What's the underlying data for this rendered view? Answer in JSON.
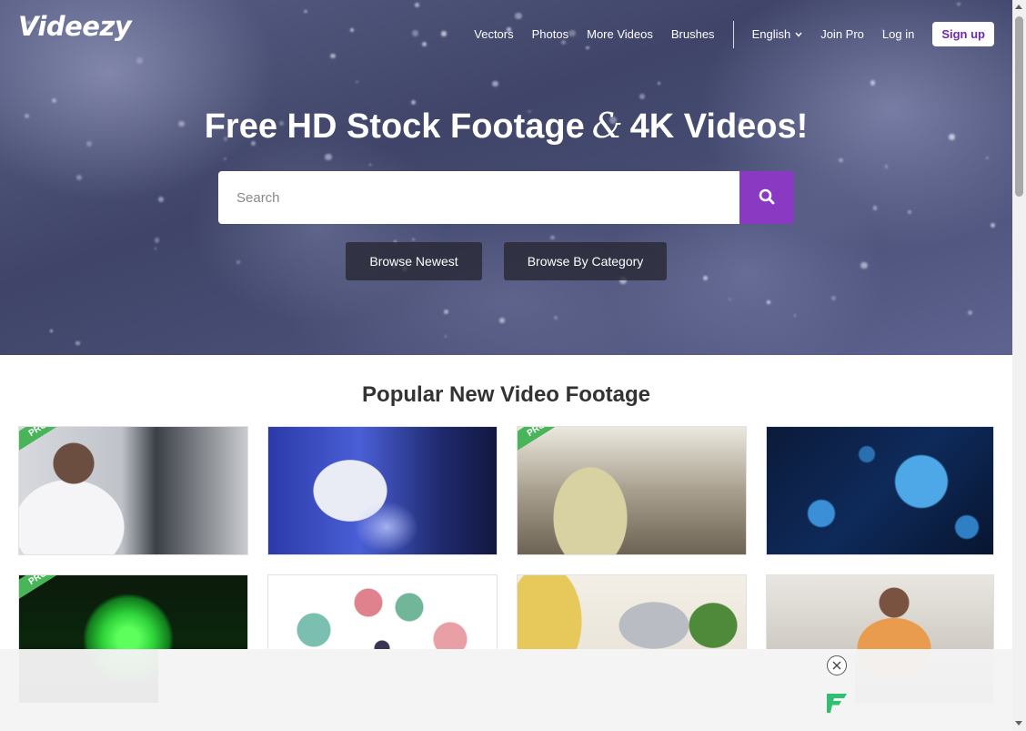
{
  "header": {
    "logo": "Videezy",
    "nav": {
      "vectors": "Vectors",
      "photos": "Photos",
      "more_videos": "More Videos",
      "brushes": "Brushes",
      "language": "English",
      "join_pro": "Join Pro",
      "log_in": "Log in",
      "sign_up": "Sign up"
    }
  },
  "hero": {
    "title_part1": "Free HD Stock Footage",
    "title_amp": "&",
    "title_part2": "4K Videos!",
    "search_placeholder": "Search",
    "search_value": "",
    "browse_newest": "Browse Newest",
    "browse_category": "Browse By Category"
  },
  "section": {
    "title": "Popular New Video Footage"
  },
  "thumbnails": [
    {
      "id": "t1",
      "pro": true,
      "pro_label": "PRO"
    },
    {
      "id": "t2",
      "pro": false
    },
    {
      "id": "t3",
      "pro": true,
      "pro_label": "PRO"
    },
    {
      "id": "t4",
      "pro": false
    },
    {
      "id": "t5",
      "pro": true,
      "pro_label": "PRO"
    },
    {
      "id": "t6",
      "pro": false
    },
    {
      "id": "t7",
      "pro": false
    },
    {
      "id": "t8",
      "pro": false
    }
  ],
  "colors": {
    "accent": "#8a3ac2",
    "signup_text": "#6c2ab0",
    "pro_badge": "#49b55a"
  },
  "icons": {
    "search": "search-icon",
    "chevron": "chevron-down-icon",
    "close": "close-icon",
    "ad_logo": "freestar-logo-icon"
  }
}
